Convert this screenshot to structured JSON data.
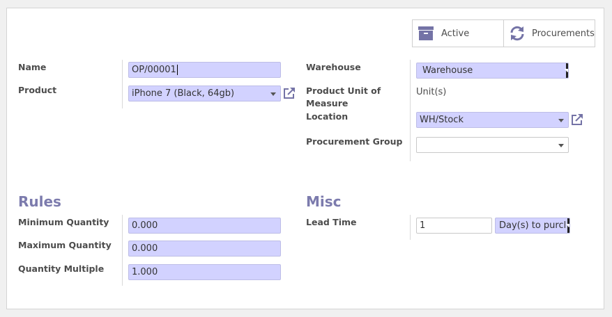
{
  "header_buttons": {
    "active_label": "Active",
    "procurements_label": "Procurements"
  },
  "left_group": {
    "name_label": "Name",
    "name_value": "OP/00001",
    "product_label": "Product",
    "product_value": "iPhone 7 (Black, 64gb)"
  },
  "right_group": {
    "warehouse_label": "Warehouse",
    "warehouse_value": "Warehouse",
    "uom_label_line1": "Product Unit of",
    "uom_label_line2": "Measure",
    "uom_value": "Unit(s)",
    "location_label": "Location",
    "location_value": "WH/Stock",
    "procurement_group_label": "Procurement Group",
    "procurement_group_value": ""
  },
  "rules": {
    "title": "Rules",
    "min_label": "Minimum Quantity",
    "min_value": "0.000",
    "max_label": "Maximum Quantity",
    "max_value": "0.000",
    "multiple_label": "Quantity Multiple",
    "multiple_value": "1.000"
  },
  "misc": {
    "title": "Misc",
    "lead_time_label": "Lead Time",
    "lead_time_value": "1",
    "lead_type_value": "Day(s) to purcl"
  },
  "colors": {
    "accent": "#7c7bad",
    "field_bg": "#d2d2ff",
    "icon": "#7473a6"
  }
}
